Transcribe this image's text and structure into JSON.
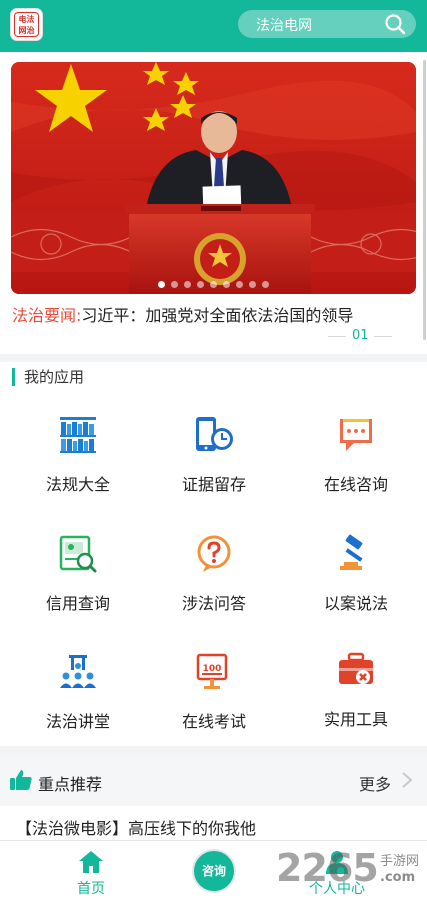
{
  "header": {
    "logo_text": "电法 网治",
    "search_placeholder": "法治电网"
  },
  "banner": {
    "slide_count": 9,
    "active_index": 0
  },
  "headline": {
    "tag": "法治要闻:",
    "text": "习近平：加强党对全面依法治国的领导"
  },
  "pager": {
    "current": "01"
  },
  "apps_section": {
    "title": "我的应用",
    "items": [
      {
        "label": "法规大全",
        "icon": "law-books-icon"
      },
      {
        "label": "证据留存",
        "icon": "evidence-clock-icon"
      },
      {
        "label": "在线咨询",
        "icon": "chat-consult-icon"
      },
      {
        "label": "信用查询",
        "icon": "credit-search-icon"
      },
      {
        "label": "涉法问答",
        "icon": "question-bubble-icon"
      },
      {
        "label": "以案说法",
        "icon": "gavel-icon"
      },
      {
        "label": "法治讲堂",
        "icon": "lecture-hall-icon"
      },
      {
        "label": "在线考试",
        "icon": "exam-score-icon"
      },
      {
        "label": "实用工具",
        "icon": "toolbox-icon"
      }
    ]
  },
  "recommend": {
    "title": "重点推荐",
    "more_label": "更多",
    "items": [
      {
        "text": "【法治微电影】高压线下的你我他"
      }
    ]
  },
  "tabbar": {
    "home_label": "首页",
    "consult_label": "咨询",
    "profile_label": "个人中心"
  },
  "watermark": {
    "number": "2265",
    "text": "手游网",
    "url": ".com"
  },
  "colors": {
    "primary": "#13b79a",
    "news_tag": "#e84c3d",
    "banner_red": "#c8201a"
  }
}
